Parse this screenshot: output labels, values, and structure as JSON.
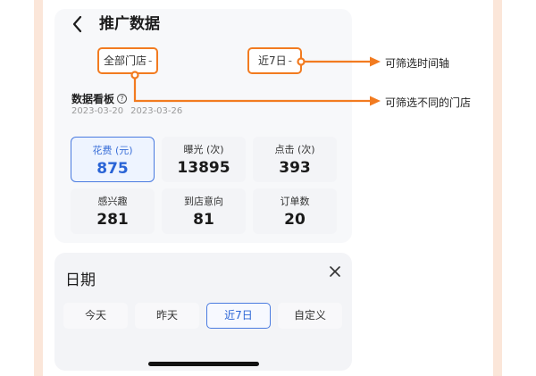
{
  "header": {
    "title": "推广数据"
  },
  "filters": {
    "store": "全部门店",
    "time": "近7日",
    "dash": "-"
  },
  "board": {
    "title": "数据看板",
    "help": "?",
    "date_start": "2023-03-20",
    "date_end": "2023-03-26"
  },
  "metrics": [
    {
      "label": "花费 (元)",
      "value": "875",
      "active": true
    },
    {
      "label": "曝光 (次)",
      "value": "13895",
      "active": false
    },
    {
      "label": "点击 (次)",
      "value": "393",
      "active": false
    },
    {
      "label": "感兴趣",
      "value": "281",
      "active": false
    },
    {
      "label": "到店意向",
      "value": "81",
      "active": false
    },
    {
      "label": "订单数",
      "value": "20",
      "active": false
    }
  ],
  "annotations": {
    "time_filter": "可筛选时间轴",
    "store_filter": "可筛选不同的门店"
  },
  "sheet": {
    "title": "日期",
    "ranges": [
      "今天",
      "昨天",
      "近7日",
      "自定义"
    ],
    "selected": "近7日"
  },
  "colors": {
    "accent": "#2a64d6",
    "annotation": "#f27b20",
    "stripe": "#fbe6d9"
  }
}
